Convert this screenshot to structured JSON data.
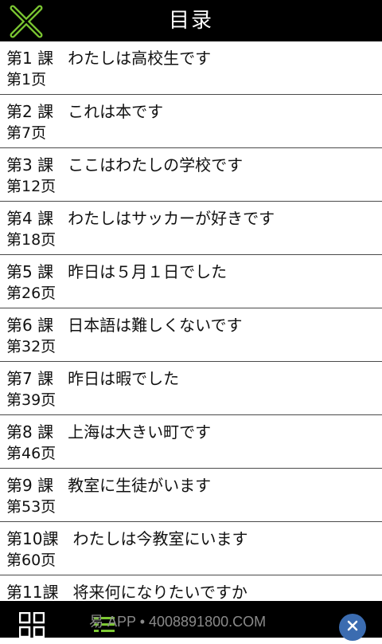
{
  "header": {
    "title": "目录",
    "accent_color": "#7cc832"
  },
  "toc": [
    {
      "lesson": "第1 課",
      "title": "わたしは高校生です",
      "page": "第1页"
    },
    {
      "lesson": "第2 課",
      "title": "これは本です",
      "page": "第7页"
    },
    {
      "lesson": "第3 課",
      "title": "ここはわたしの学校です",
      "page": "第12页"
    },
    {
      "lesson": "第4 課",
      "title": "わたしはサッカーが好きです",
      "page": "第18页"
    },
    {
      "lesson": "第5 課",
      "title": "昨日は５月１日でした",
      "page": "第26页"
    },
    {
      "lesson": "第6 課",
      "title": "日本語は難しくないです",
      "page": "第32页"
    },
    {
      "lesson": "第7 課",
      "title": "昨日は暇でした",
      "page": "第39页"
    },
    {
      "lesson": "第8 課",
      "title": "上海は大きい町です",
      "page": "第46页"
    },
    {
      "lesson": "第9 課",
      "title": "教室に生徒がいます",
      "page": "第53页"
    },
    {
      "lesson": "第10課",
      "title": "わたしは今教室にいます",
      "page": "第60页"
    },
    {
      "lesson": "第11課",
      "title": "将来何になりたいですか",
      "page": ""
    }
  ],
  "footer": {
    "watermark": "易 APP • 4008891800.COM"
  },
  "icons": {
    "close": "close-x-icon",
    "grid": "grid-icon",
    "list": "list-icon",
    "dismiss": "close-circle-icon"
  }
}
